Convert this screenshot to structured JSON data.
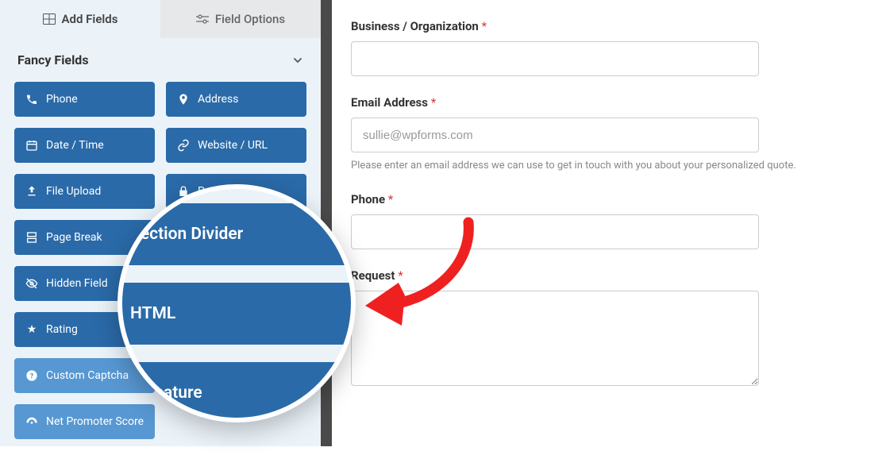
{
  "tabs": {
    "add_fields": "Add Fields",
    "field_options": "Field Options"
  },
  "section": {
    "title": "Fancy Fields"
  },
  "fields": {
    "phone": "Phone",
    "address": "Address",
    "date_time": "Date / Time",
    "website_url": "Website / URL",
    "file_upload": "File Upload",
    "password": "P",
    "page_break": "Page Break",
    "section_divider": "Section Divider",
    "hidden_field": "Hidden Field",
    "html": "HTML",
    "rating": "Rating",
    "signature": "Signature",
    "custom_captcha": "Custom Captcha",
    "net_promoter": "Net Promoter Score"
  },
  "zoom": {
    "section_divider": "Section Divider",
    "html": "HTML",
    "signature": "Signature"
  },
  "form": {
    "business": {
      "label": "Business / Organization"
    },
    "email": {
      "label": "Email Address",
      "placeholder": "sullie@wpforms.com",
      "desc": "Please enter an email address we can use to get in touch with you about your personalized quote."
    },
    "phone": {
      "label": "Phone"
    },
    "request": {
      "label": "Request"
    }
  }
}
